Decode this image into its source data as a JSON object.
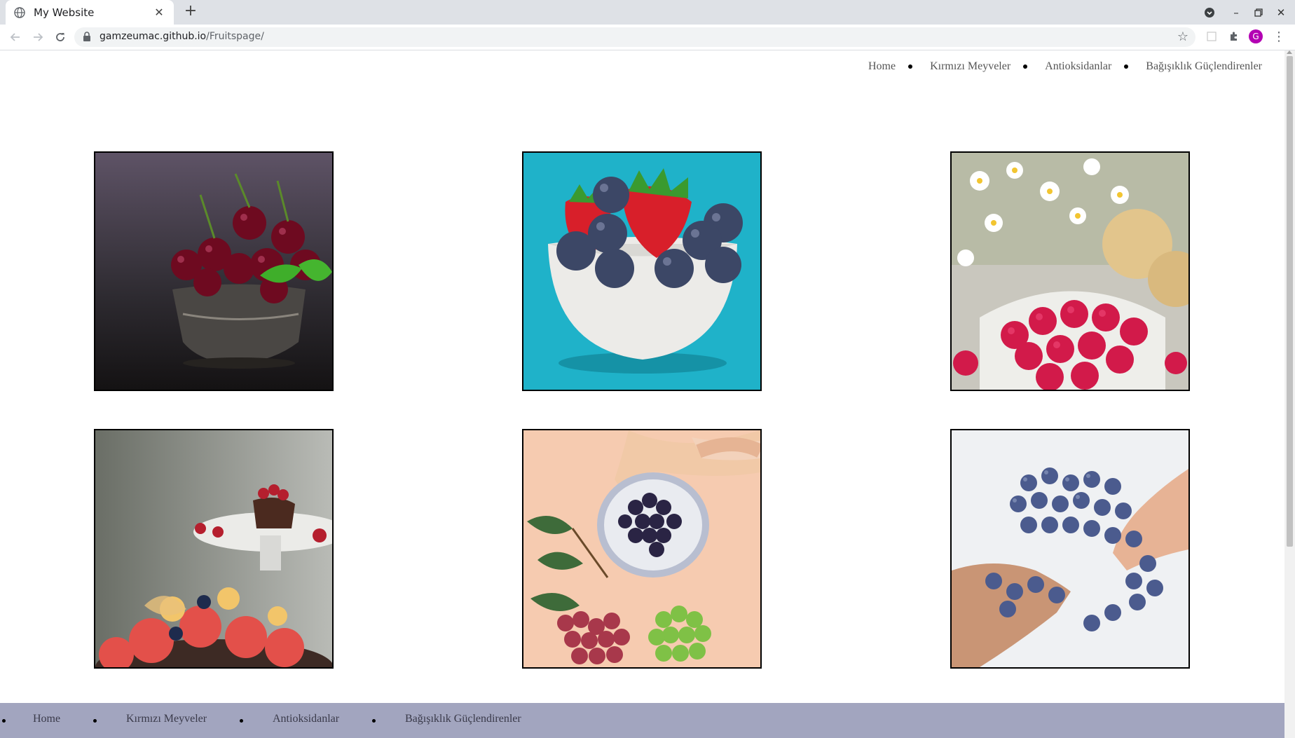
{
  "browser": {
    "tab_title": "My Website",
    "url_host": "gamzeumac.github.io",
    "url_path": "/Fruitspage/",
    "avatar_letter": "G"
  },
  "nav": {
    "items": [
      "Home",
      "Kırmızı Meyveler",
      "Antioksidanlar",
      "Bağışıklık Güçlendirenler"
    ]
  },
  "gallery": [
    {
      "name": "cherries-photo"
    },
    {
      "name": "strawberries-blueberries-photo"
    },
    {
      "name": "raspberries-photo"
    },
    {
      "name": "fruit-bowl-photo"
    },
    {
      "name": "grapes-photo"
    },
    {
      "name": "blueberries-hands-photo"
    }
  ],
  "footer": {
    "items": [
      "Home",
      "Kırmızı Meyveler",
      "Antioksidanlar",
      "Bağışıklık Güçlendirenler"
    ]
  },
  "colors": {
    "footer_bg": "#a2a5bf",
    "avatar": "#b300b3"
  }
}
